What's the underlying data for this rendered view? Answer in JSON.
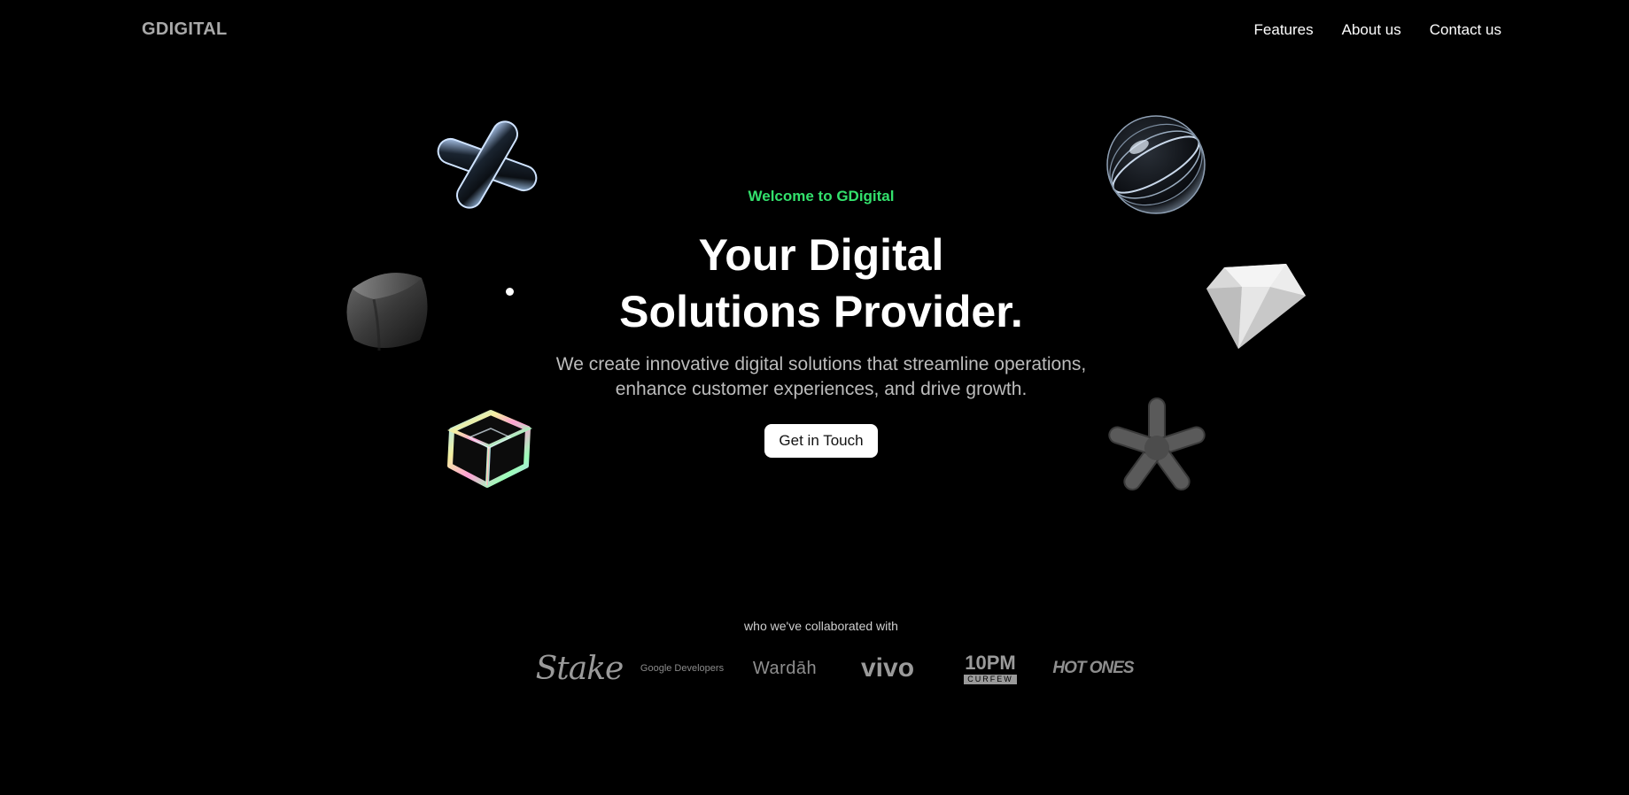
{
  "header": {
    "brand": "GDIGITAL",
    "nav": {
      "features": "Features",
      "about": "About us",
      "contact": "Contact us"
    }
  },
  "hero": {
    "welcome": "Welcome to GDigital",
    "headline_line1": "Your Digital",
    "headline_line2": "Solutions Provider.",
    "subtext_line1": "We create innovative digital solutions that streamline operations,",
    "subtext_line2": "enhance customer experiences, and drive growth.",
    "cta": "Get in Touch"
  },
  "decorations": [
    "glass-cross-shape",
    "glass-ribbon-sphere-shape",
    "dark-cube-shape",
    "white-diamond-shape",
    "prism-cube-shape",
    "dark-asterisk-shape"
  ],
  "collaborators": {
    "heading": "who we've collaborated with",
    "logos": {
      "stake": "Stake",
      "google": "Google Developers",
      "wardah": "Wardāh",
      "vivo": "vivo",
      "tenpm_top": "10PM",
      "tenpm_bottom": "CURFEW",
      "hotones": "HOT ONES"
    }
  },
  "colors": {
    "background": "#000000",
    "accent_green": "#33e06c",
    "brand_gray": "#a9a9a9",
    "cta_background": "#ffffff"
  }
}
